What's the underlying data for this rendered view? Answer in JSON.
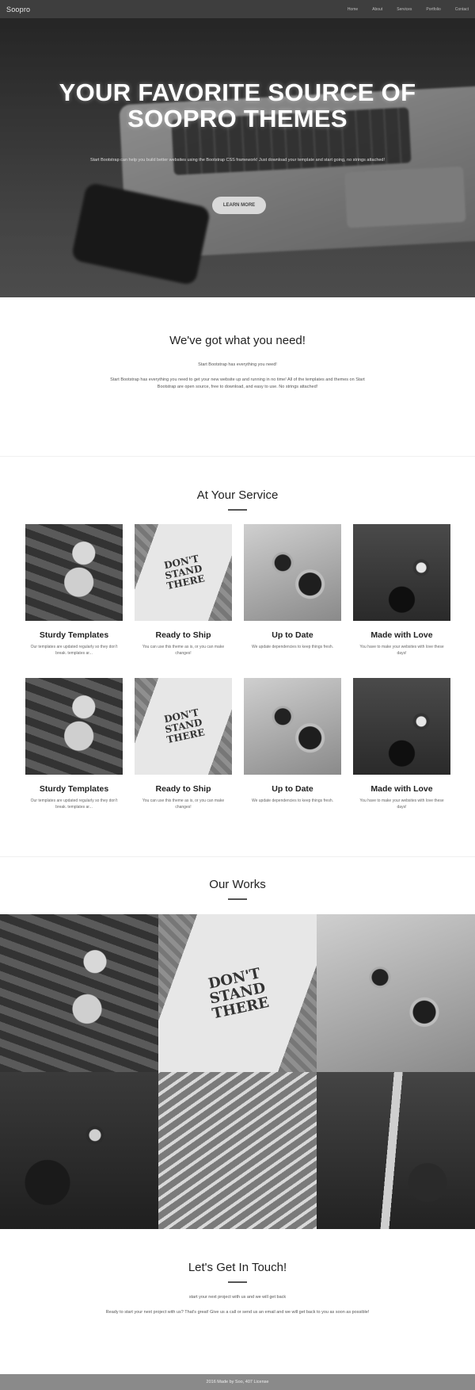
{
  "nav": {
    "brand": "Soopro",
    "links": [
      "Home",
      "About",
      "Services",
      "Portfolio",
      "Contact"
    ]
  },
  "hero": {
    "title_line1": "YOUR FAVORITE SOURCE OF",
    "title_line2": "SOOPRO THEMES",
    "subtitle": "Start Bootstrap can help you build better websites using the Bootstrap CSS framework! Just download your template and start going, no strings attached!",
    "button_label": "LEARN MORE"
  },
  "about": {
    "title": "We've got what you need!",
    "lead": "Start Bootstrap has everything you need!",
    "body": "Start Bootstrap has everything you need to get your new website up and running in no time! All of the templates and themes on Start Bootstrap are open source, free to download, and easy to use. No strings attached!"
  },
  "services": {
    "title": "At Your Service",
    "items": [
      {
        "title": "Sturdy Templates",
        "text": "Our templates are updated regularly so they don't break. templates ar..."
      },
      {
        "title": "Ready to Ship",
        "text": "You can use this theme as is, or you can make changes!"
      },
      {
        "title": "Up to Date",
        "text": "We update dependencies to keep things fresh."
      },
      {
        "title": "Made with Love",
        "text": "You have to make your websites with love these days!"
      },
      {
        "title": "Sturdy Templates",
        "text": "Our templates are updated regularly so they don't break. templates ar..."
      },
      {
        "title": "Ready to Ship",
        "text": "You can use this theme as is, or you can make changes!"
      },
      {
        "title": "Up to Date",
        "text": "We update dependencies to keep things fresh."
      },
      {
        "title": "Made with Love",
        "text": "You have to make your websites with love these days!"
      }
    ],
    "image_caption": "DON'T STAND THERE"
  },
  "works": {
    "title": "Our Works"
  },
  "contact": {
    "title": "Let's Get In Touch!",
    "lead": "start your next project with us and we will get back",
    "body": "Ready to start your next project with us? That's great! Give us a call or send us an email and we will get back to you as soon as possible!"
  },
  "footer": {
    "text": "2016 Made by Soo, 407 License"
  }
}
